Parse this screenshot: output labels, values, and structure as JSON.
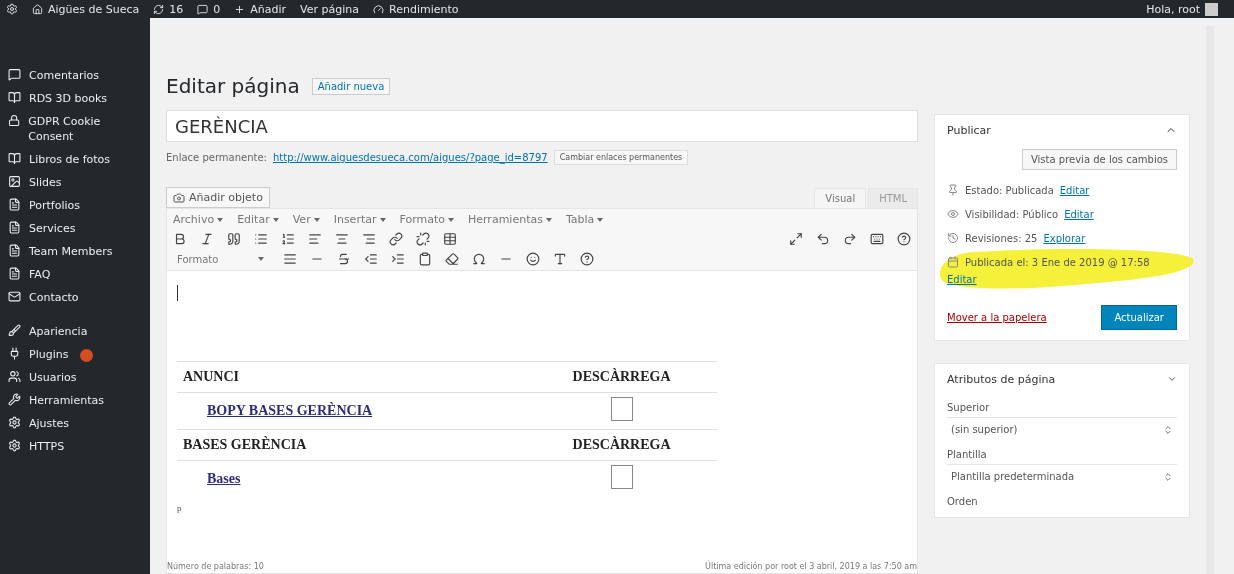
{
  "admin_bar": {
    "site": "Aigües de Sueca",
    "updates": "16",
    "comments": "0",
    "add": "Añadir",
    "view": "Ver página",
    "performance": "Rendimiento",
    "greeting": "Hola, root"
  },
  "sidebar": {
    "items": [
      {
        "label": "Comentarios",
        "badge": false
      },
      {
        "label": "RDS 3D books",
        "badge": false
      },
      {
        "label": "GDPR Cookie Consent",
        "badge": false
      },
      {
        "label": "Libros de fotos",
        "badge": false
      },
      {
        "label": "Slides",
        "badge": false
      },
      {
        "label": "Portfolios",
        "badge": false
      },
      {
        "label": "Services",
        "badge": false
      },
      {
        "label": "Team Members",
        "badge": false
      },
      {
        "label": "FAQ",
        "badge": false
      },
      {
        "label": "Contacto",
        "badge": false
      },
      {
        "label": "Apariencia",
        "badge": false
      },
      {
        "label": "Plugins",
        "badge": true
      },
      {
        "label": "Usuarios",
        "badge": false
      },
      {
        "label": "Herramientas",
        "badge": false
      },
      {
        "label": "Ajustes",
        "badge": false
      },
      {
        "label": "HTTPS",
        "badge": false
      }
    ]
  },
  "page": {
    "heading": "Editar página",
    "add_new": "Añadir nueva",
    "title_value": "GERÈNCIA",
    "permalink_label": "Enlace permanente:",
    "permalink_url": "http://www.aiguesdesueca.com/aigues/?page_id=8797",
    "permalink_button": "Cambiar enlaces permanentes"
  },
  "editor": {
    "add_media": "Añadir objeto",
    "tabs": [
      {
        "label": "Visual",
        "selected": true
      },
      {
        "label": "HTML",
        "selected": false
      }
    ],
    "menus": [
      "Archivo",
      "Editar",
      "Ver",
      "Insertar",
      "Formato",
      "Herramientas",
      "Tabla"
    ],
    "format_select": "Formato",
    "table": [
      {
        "kind": "header",
        "col_1": "ANUNCI",
        "col_2": "DESCÀRREGA"
      },
      {
        "kind": "link",
        "col_1": "BOPY BASES GERÈNCIA"
      },
      {
        "kind": "header",
        "col_1": "BASES GERÈNCIA",
        "col_2": "DESCÀRREGA"
      },
      {
        "kind": "link",
        "col_1": "Bases"
      }
    ],
    "path": "p",
    "word_count": "Número de palabras: 10",
    "last_edit": "Última edición por root el 3 abril, 2019 a las 7:50 am"
  },
  "publish": {
    "title": "Publicar",
    "preview": "Vista previa de los cambios",
    "rows": [
      {
        "label": "Estado: Publicada",
        "link": "Editar",
        "highlighted": false
      },
      {
        "label": "Visibilidad: Público",
        "link": "Editar",
        "highlighted": false
      },
      {
        "label": "Revisiones: 25",
        "link": "Explorar",
        "highlighted": false
      },
      {
        "label": "Publicada el: 3 Ene de 2019 @ 17:58",
        "link": "Editar",
        "highlighted": true
      }
    ],
    "trash": "Mover a la papelera",
    "update": "Actualizar"
  },
  "attributes": {
    "title": "Atributos de página",
    "parent_label": "Superior",
    "parent_value": "(sin superior)",
    "template_label": "Plantilla",
    "template_value": "Plantilla predeterminada",
    "order_label": "Orden"
  }
}
